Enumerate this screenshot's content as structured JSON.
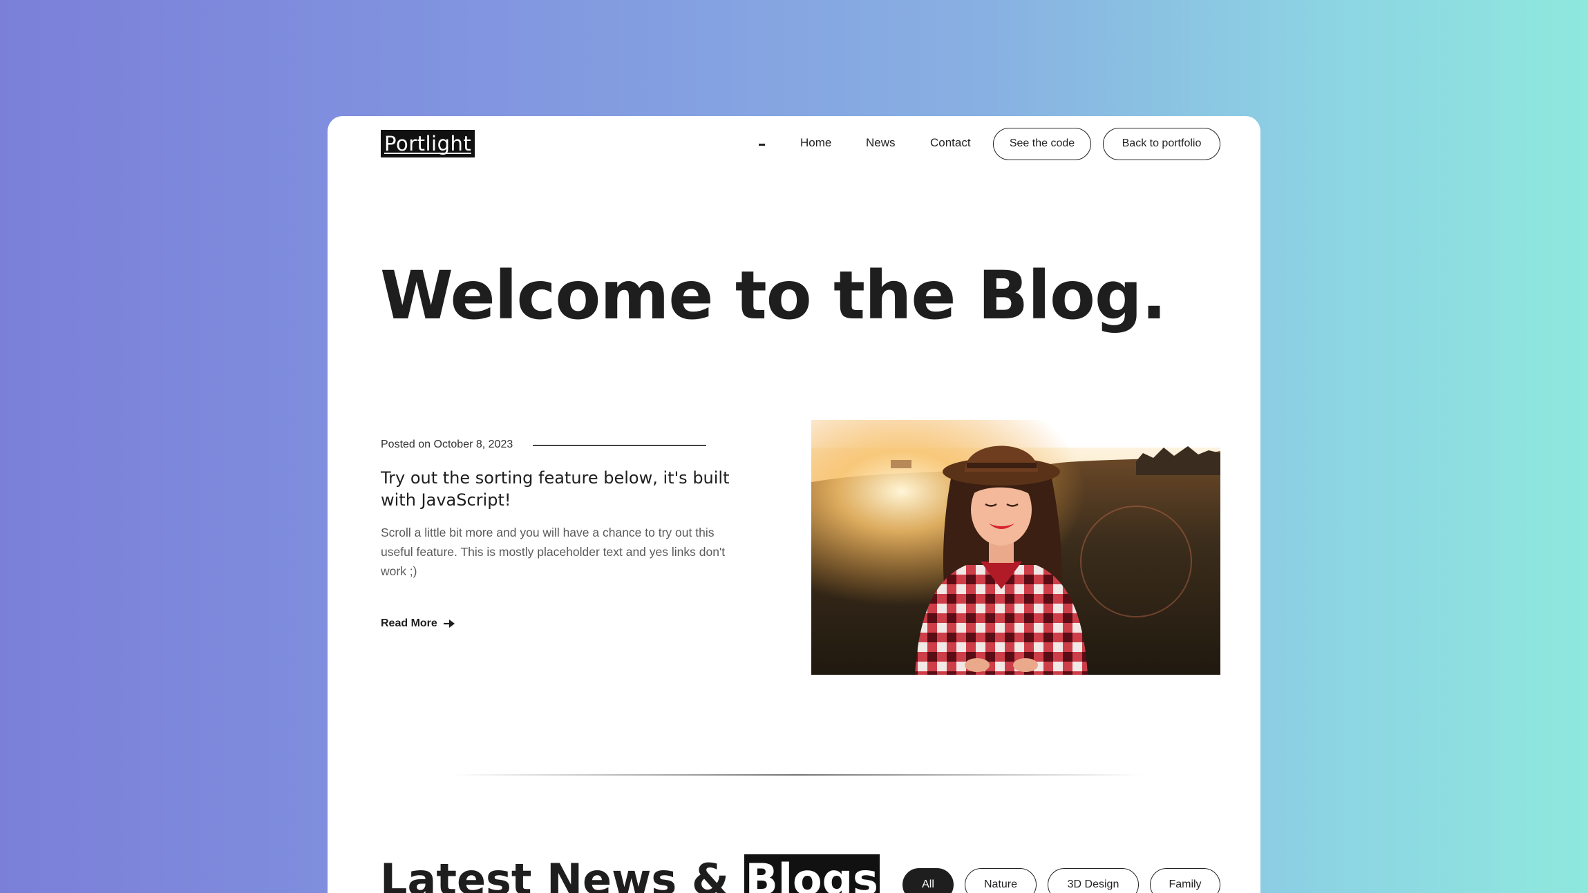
{
  "header": {
    "logo": "Portlight",
    "nav": [
      "Home",
      "News",
      "Contact"
    ],
    "buttons": [
      "See the code",
      "Back to portfolio"
    ]
  },
  "hero": {
    "title": "Welcome to the Blog."
  },
  "featured_post": {
    "meta": "Posted on October 8, 2023",
    "title": "Try out the sorting feature below, it's built with JavaScript!",
    "excerpt": "Scroll a little bit more and you will have a chance to try out this useful feature. This is mostly placeholder text and yes links don't work ;)",
    "read_more": "Read More",
    "image_icon": "woman-in-field-photo"
  },
  "latest": {
    "title_plain": "Latest News & ",
    "title_highlight": "Blogs",
    "filters": [
      "All",
      "Nature",
      "3D Design",
      "Family"
    ],
    "active_filter": "All"
  },
  "colors": {
    "background_gradient_start": "#7b7fd8",
    "background_gradient_end": "#8ee8dd",
    "text": "#1e1e1e",
    "card": "#ffffff"
  }
}
